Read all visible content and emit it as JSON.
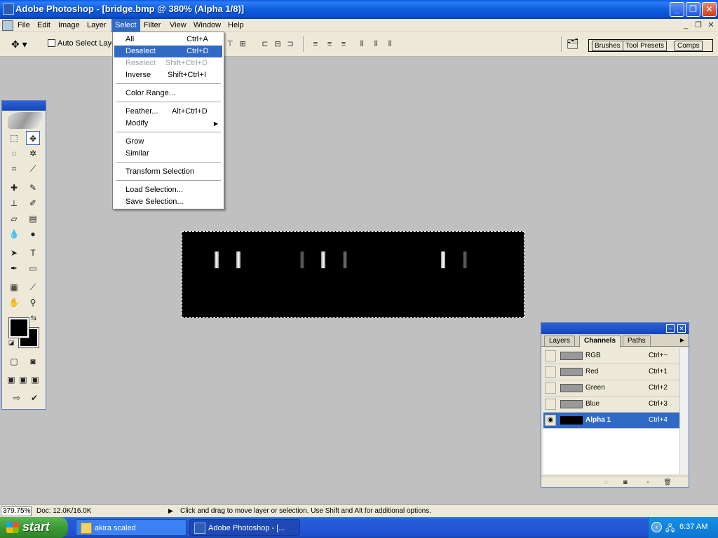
{
  "window": {
    "title": "Adobe Photoshop - [bridge.bmp @ 380% (Alpha 1/8)]",
    "minimize": "_",
    "maximize": "❐",
    "close": "✕"
  },
  "menubar": {
    "items": [
      "File",
      "Edit",
      "Image",
      "Layer",
      "Select",
      "Filter",
      "View",
      "Window",
      "Help"
    ],
    "active": "Select",
    "doc_minimize": "_",
    "doc_restore": "❐",
    "doc_close": "✕"
  },
  "options": {
    "tool_icon": "move-tool-icon",
    "auto_select_label": "Auto Select Layer",
    "well_tabs": [
      "Brushes",
      "Tool Presets",
      "Comps"
    ]
  },
  "select_menu": {
    "items": [
      {
        "label": "All",
        "shortcut": "Ctrl+A"
      },
      {
        "label": "Deselect",
        "shortcut": "Ctrl+D",
        "highlighted": true
      },
      {
        "label": "Reselect",
        "shortcut": "Shift+Ctrl+D",
        "disabled": true
      },
      {
        "label": "Inverse",
        "shortcut": "Shift+Ctrl+I"
      },
      {
        "label": "Color Range...",
        "shortcut": ""
      },
      {
        "label": "Feather...",
        "shortcut": "Alt+Ctrl+D"
      },
      {
        "label": "Modify",
        "shortcut": "",
        "submenu": true
      },
      {
        "label": "Grow",
        "shortcut": ""
      },
      {
        "label": "Similar",
        "shortcut": ""
      },
      {
        "label": "Transform Selection",
        "shortcut": ""
      },
      {
        "label": "Load Selection...",
        "shortcut": ""
      },
      {
        "label": "Save Selection...",
        "shortcut": ""
      }
    ]
  },
  "channels_palette": {
    "tabs": [
      "Layers",
      "Channels",
      "Paths"
    ],
    "active_tab": "Channels",
    "rows": [
      {
        "name": "RGB",
        "shortcut": "Ctrl+~"
      },
      {
        "name": "Red",
        "shortcut": "Ctrl+1"
      },
      {
        "name": "Green",
        "shortcut": "Ctrl+2"
      },
      {
        "name": "Blue",
        "shortcut": "Ctrl+3"
      },
      {
        "name": "Alpha 1",
        "shortcut": "Ctrl+4",
        "selected": true,
        "visible": true
      }
    ]
  },
  "statusbar": {
    "zoom": "379.75%",
    "doc": "Doc: 12.0K/16.0K",
    "message": "Click and drag to move layer or selection.  Use Shift and Alt for additional options."
  },
  "taskbar": {
    "start_label": "start",
    "tasks": [
      "akira scaled",
      "Adobe Photoshop - [..."
    ],
    "clock": "6:37 AM"
  },
  "colors": {
    "accent": "#316ac5",
    "titlebar": "#0a5ae6",
    "canvas": "#000000",
    "workspace": "#c0c0c0"
  }
}
